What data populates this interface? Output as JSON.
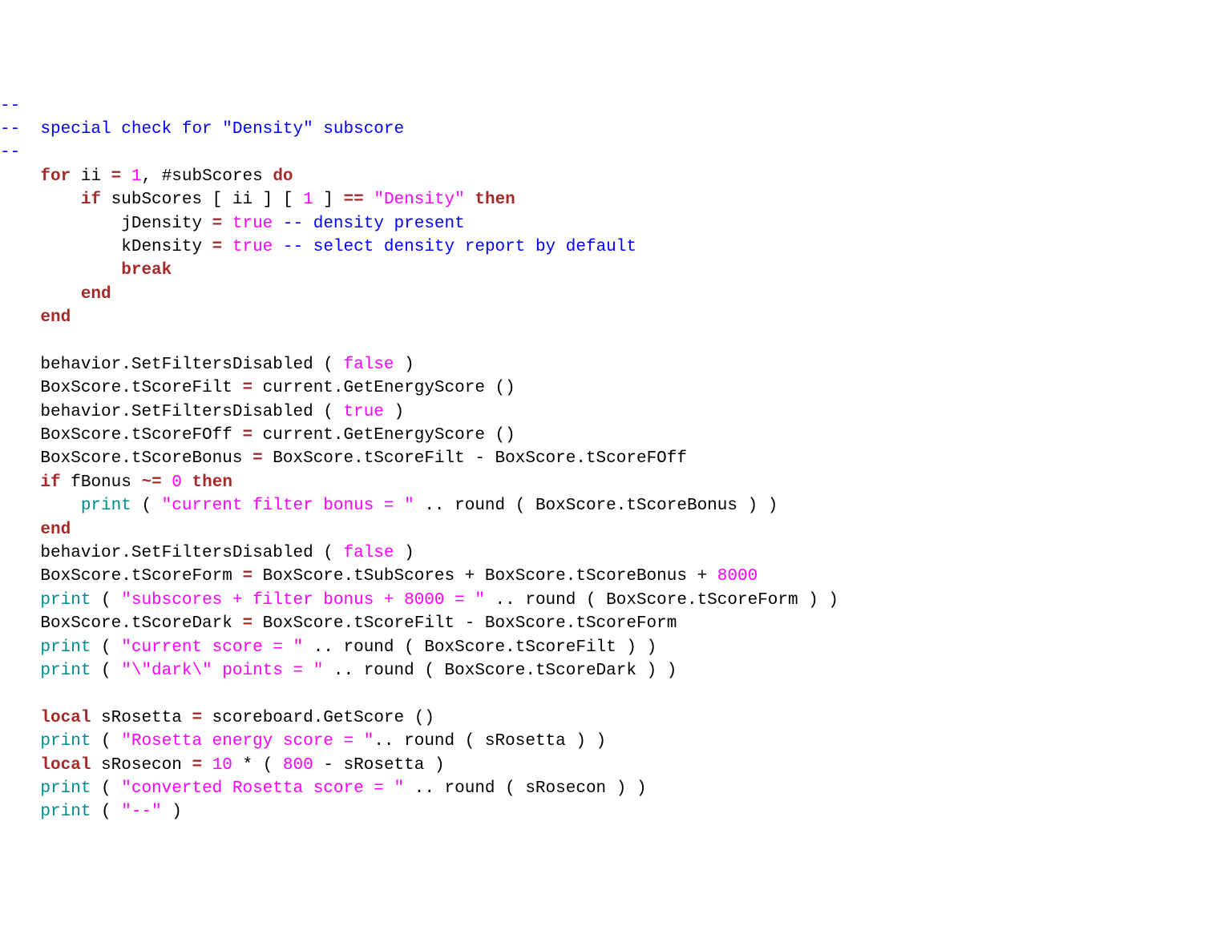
{
  "code": {
    "l1": "--",
    "l2a": "--  ",
    "l2b": "special check for \"Density\" subscore",
    "l3": "--",
    "l4_for": "for",
    "l4_ii": " ii ",
    "l4_eq": "=",
    "l4_sp": " ",
    "l4_1": "1",
    "l4_comma": ", #subScores ",
    "l4_do": "do",
    "l5_if": "if",
    "l5_body": " subScores [ ii ] [ ",
    "l5_1": "1",
    "l5_body2": " ] ",
    "l5_eq": "==",
    "l5_sp": " ",
    "l5_str": "\"Density\"",
    "l5_sp2": " ",
    "l5_then": "then",
    "l6_id": "jDensity ",
    "l6_eq": "=",
    "l6_sp": " ",
    "l6_true": "true",
    "l6_sp2": " ",
    "l6_c": "-- density present",
    "l7_id": "kDensity ",
    "l7_eq": "=",
    "l7_sp": " ",
    "l7_true": "true",
    "l7_sp2": " ",
    "l7_c": "-- select density report by default",
    "l8_break": "break",
    "l9_end": "end",
    "l10_end": "end",
    "l12": "behavior.SetFiltersDisabled ( ",
    "l12_false": "false",
    "l12b": " )",
    "l13": "BoxScore.tScoreFilt ",
    "l13_eq": "=",
    "l13b": " current.GetEnergyScore ()",
    "l14": "behavior.SetFiltersDisabled ( ",
    "l14_true": "true",
    "l14b": " )",
    "l15": "BoxScore.tScoreFOff ",
    "l15_eq": "=",
    "l15b": " current.GetEnergyScore ()",
    "l16": "BoxScore.tScoreBonus ",
    "l16_eq": "=",
    "l16b": " BoxScore.tScoreFilt - BoxScore.tScoreFOff",
    "l17_if": "if",
    "l17a": " fBonus ",
    "l17_ne": "~=",
    "l17_sp": " ",
    "l17_0": "0",
    "l17_sp2": " ",
    "l17_then": "then",
    "l18_print": "print",
    "l18a": " ( ",
    "l18_str": "\"current filter bonus = \"",
    "l18b": " .. round ( BoxScore.tScoreBonus ) )",
    "l19_end": "end",
    "l20": "behavior.SetFiltersDisabled ( ",
    "l20_false": "false",
    "l20b": " )",
    "l21": "BoxScore.tScoreForm ",
    "l21_eq": "=",
    "l21b": " BoxScore.tSubScores + BoxScore.tScoreBonus + ",
    "l21_8000": "8000",
    "l22_print": "print",
    "l22a": " ( ",
    "l22_str": "\"subscores + filter bonus + 8000 = \"",
    "l22b": " .. round ( BoxScore.tScoreForm ) )",
    "l23": "BoxScore.tScoreDark ",
    "l23_eq": "=",
    "l23b": " BoxScore.tScoreFilt - BoxScore.tScoreForm",
    "l24_print": "print",
    "l24a": " ( ",
    "l24_str": "\"current score = \"",
    "l24b": " .. round ( BoxScore.tScoreFilt ) )",
    "l25_print": "print",
    "l25a": " ( ",
    "l25_str": "\"\\\"dark\\\" points = \"",
    "l25b": " .. round ( BoxScore.tScoreDark ) )",
    "l27_local": "local",
    "l27a": " sRosetta ",
    "l27_eq": "=",
    "l27b": " scoreboard.GetScore ()",
    "l28_print": "print",
    "l28a": " ( ",
    "l28_str": "\"Rosetta energy score = \"",
    "l28b": ".. round ( sRosetta ) )",
    "l29_local": "local",
    "l29a": " sRosecon ",
    "l29_eq": "=",
    "l29_sp": " ",
    "l29_10": "10",
    "l29b": " * ( ",
    "l29_800": "800",
    "l29c": " - sRosetta )",
    "l30_print": "print",
    "l30a": " ( ",
    "l30_str": "\"converted Rosetta score = \"",
    "l30b": " .. round ( sRosecon ) )",
    "l31_print": "print",
    "l31a": " ( ",
    "l31_str": "\"--\"",
    "l31b": " )"
  }
}
